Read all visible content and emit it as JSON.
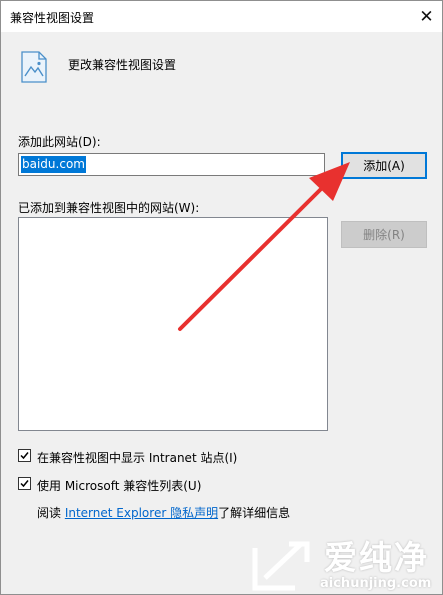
{
  "window": {
    "title": "兼容性视图设置",
    "close_glyph": "✕"
  },
  "header": {
    "text": "更改兼容性视图设置",
    "icon": "compat-view-page-icon"
  },
  "add_site": {
    "label": "添加此网站(D):",
    "value": "baidu.com",
    "button_label": "添加(A)"
  },
  "added_sites": {
    "label": "已添加到兼容性视图中的网站(W):",
    "items": [],
    "remove_button_label": "删除(R)"
  },
  "options": [
    {
      "label": "在兼容性视图中显示 Intranet 站点(I)",
      "checked": true
    },
    {
      "label": "使用 Microsoft 兼容性列表(U)",
      "checked": true
    }
  ],
  "privacy": {
    "prefix": "阅读 ",
    "link": "Internet Explorer 隐私声明",
    "suffix": "了解详细信息"
  },
  "watermark": {
    "brand": "爱纯净",
    "url": "aichunjing.com"
  },
  "colors": {
    "accent": "#0078d7",
    "arrow": "#e8312f",
    "link": "#0066cc"
  }
}
